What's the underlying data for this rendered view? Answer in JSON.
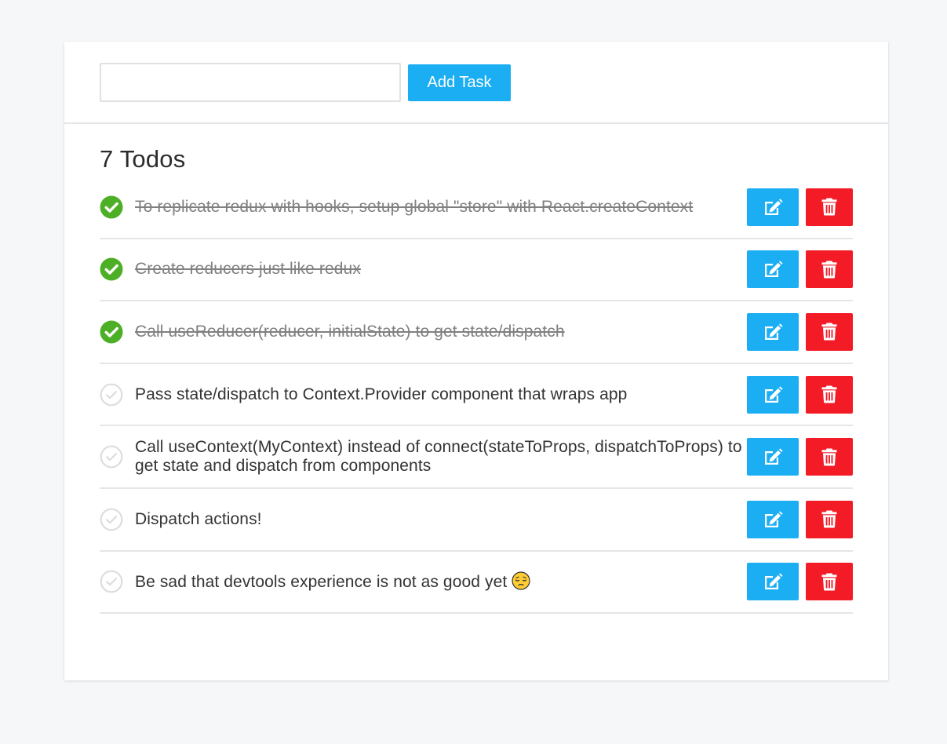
{
  "add_bar": {
    "input_value": "",
    "button_label": "Add Task"
  },
  "list": {
    "title": "7 Todos",
    "items": [
      {
        "text": "To replicate redux with hooks, setup global \"store\" with React.createContext",
        "done": true
      },
      {
        "text": "Create reducers just like redux",
        "done": true
      },
      {
        "text": "Call useReducer(reducer, initialState) to get state/dispatch",
        "done": true
      },
      {
        "text": "Pass state/dispatch to Context.Provider component that wraps app",
        "done": false
      },
      {
        "text": "Call useContext(MyContext) instead of connect(stateToProps, dispatchToProps) to get state and dispatch from components",
        "done": false
      },
      {
        "text": "Dispatch actions!",
        "done": false
      },
      {
        "text": "Be sad that devtools experience is not as good yet",
        "done": false,
        "emoji": "pensive-face"
      }
    ]
  },
  "icons": {
    "done": "check-circle-filled-icon",
    "not_done": "check-circle-outline-icon",
    "edit": "edit-icon",
    "delete": "trash-icon"
  },
  "colors": {
    "primary": "#1baef3",
    "danger": "#f31b26",
    "done_check": "#4caf25",
    "pending_check": "#dddddd",
    "background": "#f6f7f9"
  }
}
